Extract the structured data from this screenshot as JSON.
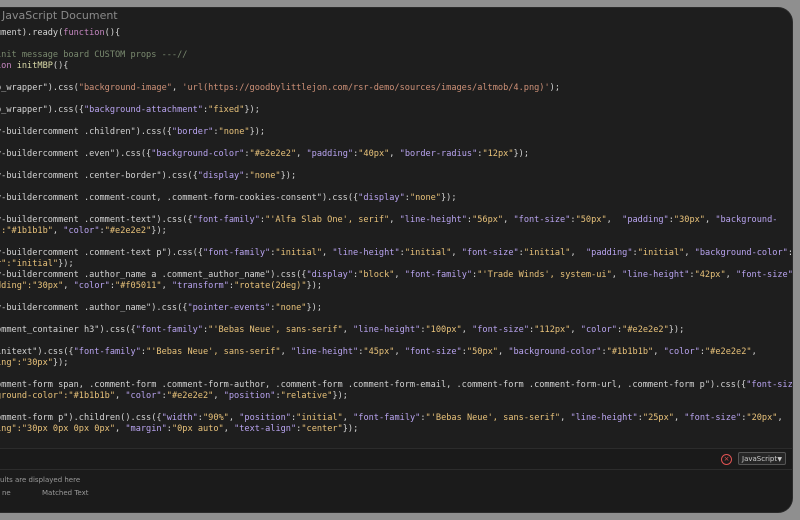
{
  "window": {
    "title": "JavaScript Document"
  },
  "code": [
    {
      "t": [
        [
          "w",
          "ument).ready("
        ],
        [
          "k",
          "function"
        ],
        [
          "w",
          "(){"
        ]
      ]
    },
    {
      "gap": true
    },
    {
      "t": [
        [
          "c",
          "init message board CUSTOM props ---//"
        ]
      ]
    },
    {
      "t": [
        [
          "k",
          "ion "
        ],
        [
          "f",
          "initMBP"
        ],
        [
          "w",
          "(){"
        ]
      ]
    },
    {
      "gap": true
    },
    {
      "t": [
        [
          "w",
          "p_wrapper\").css("
        ],
        [
          "s",
          "\"background-image\""
        ],
        [
          "w",
          ", "
        ],
        [
          "s",
          "'url(https://goodbylittlejon.com/rsr-demo/sources/images/altmob/4.png)'"
        ],
        [
          "w",
          ");"
        ]
      ]
    },
    {
      "gap": true
    },
    {
      "t": [
        [
          "w",
          "p_wrapper\").css({"
        ],
        [
          "p",
          "\"background-attachment\""
        ],
        [
          "w",
          ":"
        ],
        [
          "v",
          "\"fixed\""
        ],
        [
          "w",
          "});"
        ]
      ]
    },
    {
      "gap": true
    },
    {
      "t": [
        [
          "w",
          "v-buildercomment .children\").css({"
        ],
        [
          "p",
          "\"border\""
        ],
        [
          "w",
          ":"
        ],
        [
          "v",
          "\"none\""
        ],
        [
          "w",
          "});"
        ]
      ]
    },
    {
      "gap": true
    },
    {
      "t": [
        [
          "w",
          "v-buildercomment .even\").css({"
        ],
        [
          "p",
          "\"background-color\""
        ],
        [
          "w",
          ":"
        ],
        [
          "v",
          "\"#e2e2e2\""
        ],
        [
          "w",
          ", "
        ],
        [
          "p",
          "\"padding\""
        ],
        [
          "w",
          ":"
        ],
        [
          "v",
          "\"40px\""
        ],
        [
          "w",
          ", "
        ],
        [
          "p",
          "\"border-radius\""
        ],
        [
          "w",
          ":"
        ],
        [
          "v",
          "\"12px\""
        ],
        [
          "w",
          "});"
        ]
      ]
    },
    {
      "gap": true
    },
    {
      "t": [
        [
          "w",
          "v-buildercomment .center-border\").css({"
        ],
        [
          "p",
          "\"display\""
        ],
        [
          "w",
          ":"
        ],
        [
          "v",
          "\"none\""
        ],
        [
          "w",
          "});"
        ]
      ]
    },
    {
      "gap": true
    },
    {
      "t": [
        [
          "w",
          "v-buildercomment .comment-count, .comment-form-cookies-consent\").css({"
        ],
        [
          "p",
          "\"display\""
        ],
        [
          "w",
          ":"
        ],
        [
          "v",
          "\"none\""
        ],
        [
          "w",
          "});"
        ]
      ]
    },
    {
      "gap": true
    },
    {
      "t": [
        [
          "w",
          "v-buildercomment .comment-text\").css({"
        ],
        [
          "p",
          "\"font-family\""
        ],
        [
          "w",
          ":"
        ],
        [
          "v",
          "\"'Alfa Slab One', serif\""
        ],
        [
          "w",
          ", "
        ],
        [
          "p",
          "\"line-height\""
        ],
        [
          "w",
          ":"
        ],
        [
          "v",
          "\"56px\""
        ],
        [
          "w",
          ", "
        ],
        [
          "p",
          "\"font-size\""
        ],
        [
          "w",
          ":"
        ],
        [
          "v",
          "\"50px\""
        ],
        [
          "w",
          ",  "
        ],
        [
          "p",
          "\"padding\""
        ],
        [
          "w",
          ":"
        ],
        [
          "v",
          "\"30px\""
        ],
        [
          "w",
          ", "
        ],
        [
          "p",
          "\"background-"
        ]
      ]
    },
    {
      "t": [
        [
          "v",
          "\":\"#1b1b1b\""
        ],
        [
          "w",
          ", "
        ],
        [
          "p",
          "\"color\""
        ],
        [
          "w",
          ":"
        ],
        [
          "v",
          "\"#e2e2e2\""
        ],
        [
          "w",
          "});"
        ]
      ]
    },
    {
      "gap": true
    },
    {
      "t": [
        [
          "w",
          "v-buildercomment .comment-text p\").css({"
        ],
        [
          "p",
          "\"font-family\""
        ],
        [
          "w",
          ":"
        ],
        [
          "v",
          "\"initial\""
        ],
        [
          "w",
          ", "
        ],
        [
          "p",
          "\"line-height\""
        ],
        [
          "w",
          ":"
        ],
        [
          "v",
          "\"initial\""
        ],
        [
          "w",
          ", "
        ],
        [
          "p",
          "\"font-size\""
        ],
        [
          "w",
          ":"
        ],
        [
          "v",
          "\"initial\""
        ],
        [
          "w",
          ",  "
        ],
        [
          "p",
          "\"padding\""
        ],
        [
          "w",
          ":"
        ],
        [
          "v",
          "\"initial\""
        ],
        [
          "w",
          ", "
        ],
        [
          "p",
          "\"background-color\""
        ],
        [
          "w",
          ":\""
        ]
      ]
    },
    {
      "t": [
        [
          "v",
          "r\":\"initial\""
        ],
        [
          "w",
          "});"
        ]
      ]
    },
    {
      "t": [
        [
          "w",
          "v-buildercomment .author_name a .comment_author_name\").css({"
        ],
        [
          "p",
          "\"display\""
        ],
        [
          "w",
          ":"
        ],
        [
          "v",
          "\"block\""
        ],
        [
          "w",
          ", "
        ],
        [
          "p",
          "\"font-family\""
        ],
        [
          "w",
          ":"
        ],
        [
          "v",
          "\"'Trade Winds', system-ui\""
        ],
        [
          "w",
          ", "
        ],
        [
          "p",
          "\"line-height\""
        ],
        [
          "w",
          ":"
        ],
        [
          "v",
          "\"42px\""
        ],
        [
          "w",
          ", "
        ],
        [
          "p",
          "\"font-size\""
        ]
      ]
    },
    {
      "t": [
        [
          "v",
          "dding\":\"30px\""
        ],
        [
          "w",
          ", "
        ],
        [
          "p",
          "\"color\""
        ],
        [
          "w",
          ":"
        ],
        [
          "v",
          "\"#f05011\""
        ],
        [
          "w",
          ", "
        ],
        [
          "p",
          "\"transform\""
        ],
        [
          "w",
          ":"
        ],
        [
          "v",
          "\"rotate(2deg)\""
        ],
        [
          "w",
          "});"
        ]
      ]
    },
    {
      "gap": true
    },
    {
      "t": [
        [
          "w",
          "v-buildercomment .author_name\").css({"
        ],
        [
          "p",
          "\"pointer-events\""
        ],
        [
          "w",
          ":"
        ],
        [
          "v",
          "\"none\""
        ],
        [
          "w",
          "});"
        ]
      ]
    },
    {
      "gap": true
    },
    {
      "t": [
        [
          "w",
          "omment_container h3\").css({"
        ],
        [
          "p",
          "\"font-family\""
        ],
        [
          "w",
          ":"
        ],
        [
          "v",
          "\"'Bebas Neue', sans-serif\""
        ],
        [
          "w",
          ", "
        ],
        [
          "p",
          "\"line-height\""
        ],
        [
          "w",
          ":"
        ],
        [
          "v",
          "\"100px\""
        ],
        [
          "w",
          ", "
        ],
        [
          "p",
          "\"font-size\""
        ],
        [
          "w",
          ":"
        ],
        [
          "v",
          "\"112px\""
        ],
        [
          "w",
          ", "
        ],
        [
          "p",
          "\"color\""
        ],
        [
          "w",
          ":"
        ],
        [
          "v",
          "\"#e2e2e2\""
        ],
        [
          "w",
          "});"
        ]
      ]
    },
    {
      "gap": true
    },
    {
      "t": [
        [
          "w",
          "initext\").css({"
        ],
        [
          "p",
          "\"font-family\""
        ],
        [
          "w",
          ":"
        ],
        [
          "v",
          "\"'Bebas Neue', sans-serif\""
        ],
        [
          "w",
          ", "
        ],
        [
          "p",
          "\"line-height\""
        ],
        [
          "w",
          ":"
        ],
        [
          "v",
          "\"45px\""
        ],
        [
          "w",
          ", "
        ],
        [
          "p",
          "\"font-size\""
        ],
        [
          "w",
          ":"
        ],
        [
          "v",
          "\"50px\""
        ],
        [
          "w",
          ", "
        ],
        [
          "p",
          "\"background-color\""
        ],
        [
          "w",
          ":"
        ],
        [
          "v",
          "\"#1b1b1b\""
        ],
        [
          "w",
          ", "
        ],
        [
          "p",
          "\"color\""
        ],
        [
          "w",
          ":"
        ],
        [
          "v",
          "\"#e2e2e2\""
        ],
        [
          "w",
          ","
        ]
      ]
    },
    {
      "t": [
        [
          "v",
          "ing\":\"30px\""
        ],
        [
          "w",
          "});"
        ]
      ]
    },
    {
      "gap": true
    },
    {
      "t": [
        [
          "w",
          "omment-form span, .comment-form .comment-form-author, .comment-form .comment-form-email, .comment-form .comment-form-url, .comment-form p\").css({"
        ],
        [
          "p",
          "\"font-siz"
        ]
      ]
    },
    {
      "t": [
        [
          "v",
          "ground-color\":\"#1b1b1b\""
        ],
        [
          "w",
          ", "
        ],
        [
          "p",
          "\"color\""
        ],
        [
          "w",
          ":"
        ],
        [
          "v",
          "\"#e2e2e2\""
        ],
        [
          "w",
          ", "
        ],
        [
          "p",
          "\"position\""
        ],
        [
          "w",
          ":"
        ],
        [
          "v",
          "\"relative\""
        ],
        [
          "w",
          "});"
        ]
      ]
    },
    {
      "gap": true
    },
    {
      "t": [
        [
          "w",
          "omment-form p\").children().css({"
        ],
        [
          "p",
          "\"width\""
        ],
        [
          "w",
          ":"
        ],
        [
          "v",
          "\"90%\""
        ],
        [
          "w",
          ", "
        ],
        [
          "p",
          "\"position\""
        ],
        [
          "w",
          ":"
        ],
        [
          "v",
          "\"initial\""
        ],
        [
          "w",
          ", "
        ],
        [
          "p",
          "\"font-family\""
        ],
        [
          "w",
          ":"
        ],
        [
          "v",
          "\"'Bebas Neue', sans-serif\""
        ],
        [
          "w",
          ", "
        ],
        [
          "p",
          "\"line-height\""
        ],
        [
          "w",
          ":"
        ],
        [
          "v",
          "\"25px\""
        ],
        [
          "w",
          ", "
        ],
        [
          "p",
          "\"font-size\""
        ],
        [
          "w",
          ":"
        ],
        [
          "v",
          "\"20px\""
        ],
        [
          "w",
          ","
        ]
      ]
    },
    {
      "t": [
        [
          "v",
          "ing\":\"30px 0px 0px 0px\""
        ],
        [
          "w",
          ", "
        ],
        [
          "p",
          "\"margin\""
        ],
        [
          "w",
          ":"
        ],
        [
          "v",
          "\"0px auto\""
        ],
        [
          "w",
          ", "
        ],
        [
          "p",
          "\"text-align\""
        ],
        [
          "w",
          ":"
        ],
        [
          "v",
          "\"center\""
        ],
        [
          "w",
          "});"
        ]
      ]
    }
  ],
  "statusbar": {
    "language": "JavaScript",
    "error_icon": "error-circle-icon"
  },
  "results": {
    "message": "ults are displayed here",
    "col1": "ne",
    "col2": "Matched Text"
  }
}
